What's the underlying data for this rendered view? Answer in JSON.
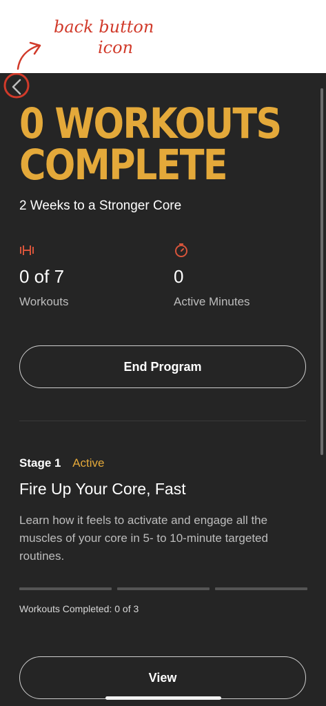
{
  "annotation": {
    "line1": "back button",
    "line2": "icon",
    "color": "#d13a2a"
  },
  "header": {
    "back_icon": "chevron-left-icon"
  },
  "summary": {
    "headline_line1": "0 WORKOUTS",
    "headline_line2": "COMPLETE",
    "program_name": "2 Weeks to a Stronger Core",
    "accent_color": "#e4a93a"
  },
  "stats": {
    "workouts": {
      "icon": "dumbbell-icon",
      "value": "0 of 7",
      "label": "Workouts"
    },
    "minutes": {
      "icon": "stopwatch-icon",
      "value": "0",
      "label": "Active Minutes"
    },
    "icon_color": "#d9553b"
  },
  "actions": {
    "end_program_label": "End Program",
    "view_label": "View"
  },
  "stage": {
    "number_label": "Stage 1",
    "status": "Active",
    "title": "Fire Up Your Core, Fast",
    "description": "Learn how it feels to activate and engage all the muscles of your core in 5- to 10-minute targeted routines.",
    "progress_completed": 0,
    "progress_total": 3,
    "completed_text": "Workouts Completed: 0 of 3"
  }
}
